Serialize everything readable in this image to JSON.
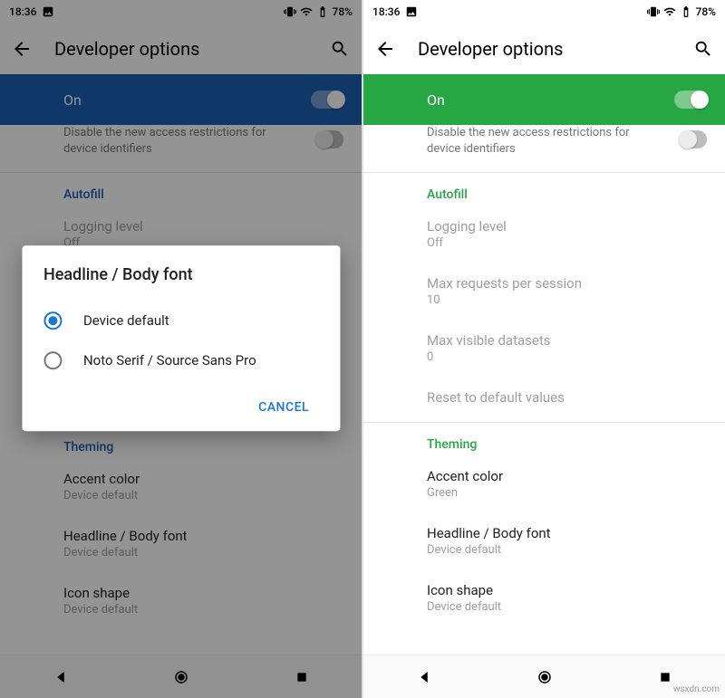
{
  "watermark": "wsxdn.com",
  "left": {
    "status": {
      "time": "18:36",
      "battery": "78%"
    },
    "appbar": {
      "title": "Developer options"
    },
    "on_label": "On",
    "restrict": {
      "sub": "Disable the new access restrictions for device identifiers"
    },
    "section_autofill": "Autofill",
    "logging": {
      "primary": "Logging level",
      "secondary": "Off"
    },
    "section_theming": "Theming",
    "accent": {
      "primary": "Accent color",
      "secondary": "Device default"
    },
    "font": {
      "primary": "Headline / Body font",
      "secondary": "Device default"
    },
    "iconshape": {
      "primary": "Icon shape",
      "secondary": "Device default"
    },
    "dialog": {
      "title": "Headline / Body font",
      "opt1": "Device default",
      "opt2": "Noto Serif / Source Sans Pro",
      "cancel": "CANCEL"
    }
  },
  "right": {
    "status": {
      "time": "18:36",
      "battery": "78%"
    },
    "appbar": {
      "title": "Developer options"
    },
    "on_label": "On",
    "restrict": {
      "sub": "Disable the new access restrictions for device identifiers"
    },
    "section_autofill": "Autofill",
    "logging": {
      "primary": "Logging level",
      "secondary": "Off"
    },
    "maxreq": {
      "primary": "Max requests per session",
      "secondary": "10"
    },
    "maxds": {
      "primary": "Max visible datasets",
      "secondary": "0"
    },
    "reset": {
      "primary": "Reset to default values"
    },
    "section_theming": "Theming",
    "accent": {
      "primary": "Accent color",
      "secondary": "Green"
    },
    "font": {
      "primary": "Headline / Body font",
      "secondary": "Device default"
    },
    "iconshape": {
      "primary": "Icon shape",
      "secondary": "Device default"
    }
  }
}
